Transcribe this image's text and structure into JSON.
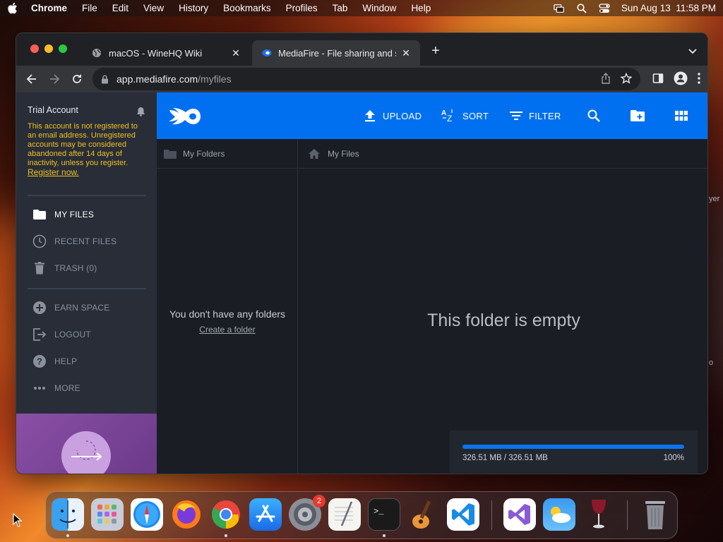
{
  "menubar": {
    "app": "Chrome",
    "items": [
      "File",
      "Edit",
      "View",
      "History",
      "Bookmarks",
      "Profiles",
      "Tab",
      "Window",
      "Help"
    ],
    "clock": "Sun Aug 13  11:58 PM"
  },
  "browser": {
    "tabs": [
      {
        "title": "macOS - WineHQ Wiki",
        "favicon": "globe-icon"
      },
      {
        "title": "MediaFire - File sharing and sto",
        "favicon": "mediafire-icon"
      }
    ],
    "url": {
      "host": "app.mediafire.com",
      "path": "/myfiles"
    }
  },
  "sidebar": {
    "account_title": "Trial Account",
    "account_note": "This account is not registered to an email address. Unregistered accounts may be considered abandoned after 14 days of inactivity, unless you register.",
    "register_link": "Register now.",
    "nav": [
      {
        "label": "MY FILES",
        "icon": "folder-icon"
      },
      {
        "label": "RECENT FILES",
        "icon": "clock-icon"
      },
      {
        "label": "TRASH (0)",
        "icon": "trash-icon"
      }
    ],
    "secondary": [
      {
        "label": "EARN SPACE",
        "icon": "plus-circle-icon"
      },
      {
        "label": "LOGOUT",
        "icon": "logout-icon"
      },
      {
        "label": "HELP",
        "icon": "help-icon"
      },
      {
        "label": "MORE",
        "icon": "more-icon"
      }
    ]
  },
  "topbar": {
    "upload": "UPLOAD",
    "sort": "SORT",
    "filter": "FILTER"
  },
  "folders_pane": {
    "header": "My Folders",
    "empty": "You don't have any folders",
    "create": "Create a folder"
  },
  "files_pane": {
    "header": "My Files",
    "empty": "This folder is empty"
  },
  "storage": {
    "used": "326.51 MB / 326.51 MB",
    "percent_label": "100%",
    "fraction": 1.0
  },
  "dock": {
    "apps": [
      "Finder",
      "Launchpad",
      "Safari",
      "Firefox",
      "Chrome",
      "App Store",
      "System Settings",
      "TextEdit",
      "Terminal",
      "GarageBand",
      "VS Code",
      "Visual Studio",
      "Weather",
      "Wine",
      "Trash"
    ],
    "settings_badge": "2"
  },
  "colors": {
    "accent": "#0070f0",
    "warning": "#f0c020"
  }
}
